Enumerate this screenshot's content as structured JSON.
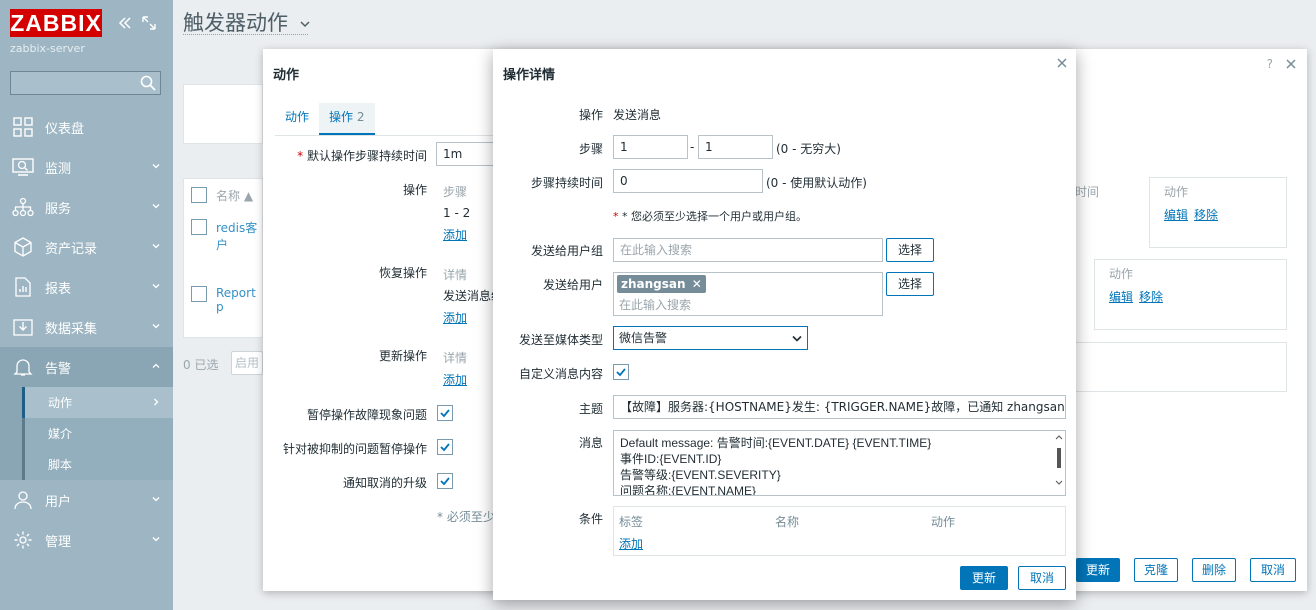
{
  "app": {
    "logo": "ZABBIX",
    "server": "zabbix-server",
    "brand_color": "#d40000",
    "accent_color": "#0275b8"
  },
  "sidebar": {
    "collapse_icon": "double-chevron-left-icon",
    "expand_icon": "expand-window-icon",
    "search_placeholder": "",
    "items": [
      {
        "label": "仪表盘",
        "icon": "dashboard-icon"
      },
      {
        "label": "监测",
        "icon": "monitoring-icon"
      },
      {
        "label": "服务",
        "icon": "services-icon"
      },
      {
        "label": "资产记录",
        "icon": "inventory-icon"
      },
      {
        "label": "报表",
        "icon": "reports-icon"
      },
      {
        "label": "数据采集",
        "icon": "data-collection-icon"
      },
      {
        "label": "告警",
        "icon": "bell-icon"
      },
      {
        "label": "用户",
        "icon": "user-icon"
      },
      {
        "label": "管理",
        "icon": "gear-icon"
      }
    ],
    "alerts_sub": [
      {
        "label": "动作",
        "active": true
      },
      {
        "label": "媒介"
      },
      {
        "label": "脚本"
      }
    ]
  },
  "header": {
    "title": "触发器动作"
  },
  "background": {
    "col_name": "名称 ▲",
    "row1": "redis客户",
    "row2": "Report p",
    "selected": "0 已选",
    "enable_btn": "启用",
    "col_interval": "时间",
    "col_action": "动作",
    "edit": "编辑",
    "remove": "移除",
    "col_action2": "动作",
    "edit2": "编辑",
    "remove2": "移除"
  },
  "action_dialog": {
    "title": "动作",
    "help": "?",
    "tabs": [
      {
        "label": "动作"
      },
      {
        "label": "操作",
        "count": "2"
      }
    ],
    "default_duration_label": "默认操作步骤持续时间",
    "default_duration_value": "1m",
    "ops_label": "操作",
    "ops_col_step": "步骤",
    "ops_step_value": "1 - 2",
    "ops_add": "添加",
    "recovery_label": "恢复操作",
    "recovery_col": "详情",
    "recovery_value": "发送消息给",
    "recovery_add": "添加",
    "update_label": "更新操作",
    "update_col": "详情",
    "update_add": "添加",
    "pause_symptoms_label": "暂停操作故障现象问题",
    "pause_suppressed_label": "针对被抑制的问题暂停操作",
    "notify_cancel_label": "通知取消的升级",
    "required_note": "* 必须至少",
    "btn_update": "更新",
    "btn_clone": "克隆",
    "btn_delete": "删除",
    "btn_cancel": "取消"
  },
  "op_dialog": {
    "title": "操作详情",
    "operation_label": "操作",
    "operation_value": "发送消息",
    "steps_label": "步骤",
    "step_from": "1",
    "step_to": "1",
    "step_hint": "(0 - 无穷大)",
    "duration_label": "步骤持续时间",
    "duration_value": "0",
    "duration_hint": "(0 - 使用默认动作)",
    "required_note": "* 您必须至少选择一个用户或用户组。",
    "send_groups_label": "发送给用户组",
    "groups_placeholder": "在此输入搜索",
    "select_btn": "选择",
    "send_users_label": "发送给用户",
    "user_tag": "zhangsan",
    "users_placeholder": "在此输入搜索",
    "select_btn2": "选择",
    "media_type_label": "发送至媒体类型",
    "media_type_value": "微信告警",
    "custom_msg_label": "自定义消息内容",
    "custom_msg_checked": true,
    "subject_label": "主题",
    "subject_value": "【故障】服务器:{HOSTNAME}发生: {TRIGGER.NAME}故障，已通知 zhangsan",
    "message_label": "消息",
    "message_lines": [
      "Default message: 告警时间:{EVENT.DATE} {EVENT.TIME}",
      "事件ID:{EVENT.ID}",
      "告警等级:{EVENT.SEVERITY}",
      "问题名称:{EVENT.NAME}"
    ],
    "conditions_label": "条件",
    "cond_col_tag": "标签",
    "cond_col_name": "名称",
    "cond_col_action": "动作",
    "cond_add": "添加",
    "btn_update": "更新",
    "btn_cancel": "取消"
  }
}
